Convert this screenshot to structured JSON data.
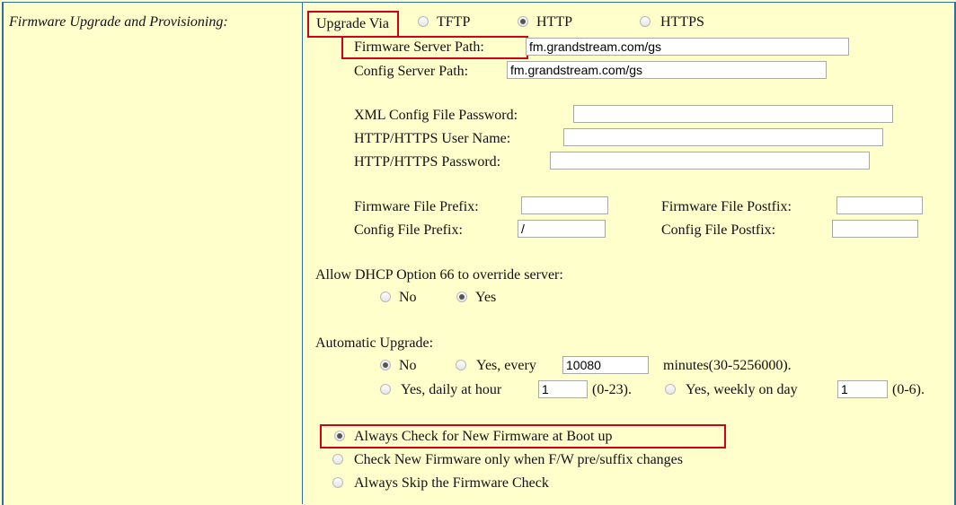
{
  "section_title": "Firmware Upgrade and Provisioning:",
  "upgrade_via": {
    "label": "Upgrade Via",
    "options": [
      "TFTP",
      "HTTP",
      "HTTPS"
    ],
    "selected": "HTTP"
  },
  "firmware_server_path": {
    "label": "Firmware Server Path:",
    "value": "fm.grandstream.com/gs"
  },
  "config_server_path": {
    "label": "Config Server Path:",
    "value": "fm.grandstream.com/gs"
  },
  "xml_config_password": {
    "label": "XML Config File Password:",
    "value": ""
  },
  "http_user_name": {
    "label": "HTTP/HTTPS User Name:",
    "value": ""
  },
  "http_password": {
    "label": "HTTP/HTTPS Password:",
    "value": ""
  },
  "firmware_file_prefix": {
    "label": "Firmware File Prefix:",
    "value": ""
  },
  "firmware_file_postfix": {
    "label": "Firmware File Postfix:",
    "value": ""
  },
  "config_file_prefix": {
    "label": "Config File Prefix:",
    "value": "/"
  },
  "config_file_postfix": {
    "label": "Config File Postfix:",
    "value": ""
  },
  "dhcp66": {
    "label": "Allow DHCP Option 66 to override server:",
    "options": [
      "No",
      "Yes"
    ],
    "selected": "Yes"
  },
  "auto_upgrade": {
    "label": "Automatic Upgrade:",
    "no": "No",
    "yes_every": "Yes, every",
    "every_value": "10080",
    "minutes_range": "minutes(30-5256000).",
    "daily_label": "Yes, daily at hour",
    "daily_value": "1",
    "daily_range": "(0-23).",
    "weekly_label": "Yes, weekly on day",
    "weekly_value": "1",
    "weekly_range": "(0-6).",
    "selected": "No"
  },
  "firmware_check": {
    "options": [
      "Always Check for New Firmware at Boot up",
      "Check New Firmware only when F/W pre/suffix changes",
      "Always Skip the Firmware Check"
    ],
    "selected": "Always Check for New Firmware at Boot up"
  },
  "highlight_color": "#d0021b"
}
